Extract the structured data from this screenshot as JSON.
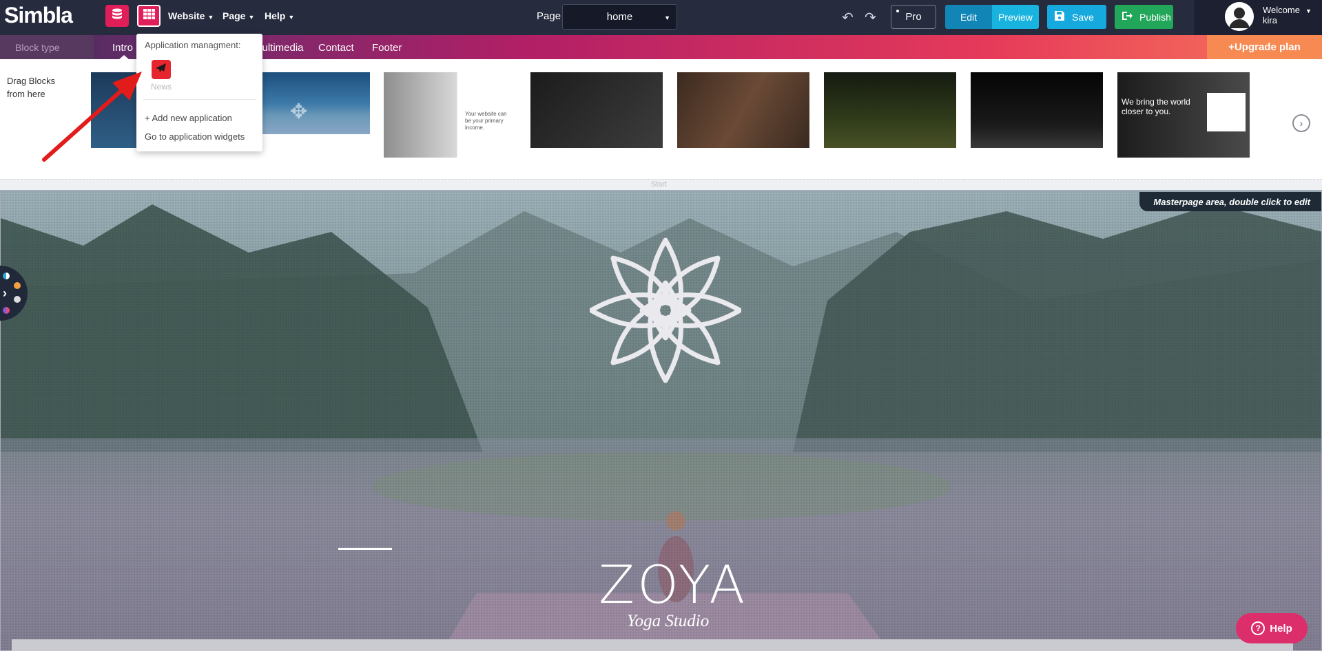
{
  "topbar": {
    "logo": "Simbla",
    "menus": [
      "Website",
      "Page",
      "Help"
    ],
    "page_label": "Page",
    "page_value": "home",
    "pro_label": "Pro",
    "edit_label": "Edit",
    "preview_label": "Preview",
    "save_label": "Save",
    "publish_label": "Publish",
    "welcome_label": "Welcome",
    "username": "kira"
  },
  "tabs": {
    "block_type": "Block type",
    "items": [
      "Intro",
      "Multimedia",
      "Contact",
      "Footer"
    ],
    "upgrade": "+Upgrade plan"
  },
  "blocks": {
    "drag_line1": "Drag Blocks",
    "drag_line2": "from here",
    "thumb3_text": "Your website can be your primary income.",
    "thumb8_text": "We bring the world closer to you."
  },
  "divider_label": "Start",
  "dropdown": {
    "title": "Application managment:",
    "app_name": "News",
    "add_link": "+ Add new application",
    "widgets_link": "Go to application widgets"
  },
  "hero": {
    "master_label": "Masterpage area, double click to edit",
    "title": "ZOYA",
    "subtitle": "Yoga Studio"
  },
  "help_label": "Help",
  "colors": {
    "accent_red": "#e01e5a",
    "topbar_bg": "#262b3e",
    "save_blue": "#15a9dd",
    "publish_green": "#22a65a",
    "upgrade_orange": "#f68a52"
  }
}
